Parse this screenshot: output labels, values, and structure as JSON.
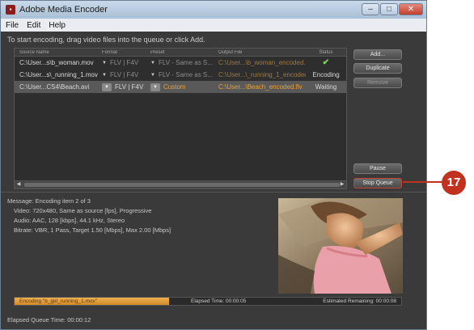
{
  "window": {
    "title": "Adobe Media Encoder",
    "app_icon": "Ae-icon"
  },
  "menu": [
    "File",
    "Edit",
    "Help"
  ],
  "hint": "To start encoding, drag video files into the queue or click Add.",
  "queue": {
    "columns": [
      "Source Name",
      "Format",
      "Preset",
      "Output File",
      "Status"
    ],
    "rows": [
      {
        "source": "C:\\User...s\\b_woman.mov",
        "format": "FLV | F4V",
        "preset": "FLV - Same as S...",
        "output": "C:\\User...\\b_woman_encoded.flv",
        "status": "",
        "status_icon": "check-icon",
        "state": "done"
      },
      {
        "source": "C:\\User...s\\_running_1.mov",
        "format": "FLV | F4V",
        "preset": "FLV - Same as S...",
        "output": "C:\\User...\\_running_1_encoded.flv",
        "status": "Encoding",
        "state": "encoding"
      },
      {
        "source": "C:\\User...CS4\\Beach.avi",
        "format": "FLV | F4V",
        "preset": "Custom",
        "output": "C:\\User...\\Beach_encoded.flv",
        "status": "Waiting",
        "state": "waiting"
      }
    ]
  },
  "buttons": {
    "add": "Add...",
    "duplicate": "Duplicate",
    "remove": "Remove",
    "pause": "Pause",
    "stop_queue": "Stop Queue"
  },
  "callout": "17",
  "message": {
    "line1": "Message: Encoding item 2 of 3",
    "video": "Video:  720x480, Same as source [fps], Progressive",
    "audio": "Audio:  AAC, 128 [kbps], 44.1 kHz, Stereo",
    "bitrate": "Bitrate:  VBR, 1 Pass, Target 1.50 [Mbps], Max 2.00 [Mbps]"
  },
  "progress": {
    "label": "Encoding \"b_girl_running_1.mov\"",
    "fraction": 0.4,
    "elapsed": "Elapsed Time:  00:00:05",
    "remaining": "Estimated Remaining:  00:00:08"
  },
  "queue_time": "Elapsed Queue Time:  00:00:12",
  "colors": {
    "accent": "#e8a23a",
    "callout": "#c0311e",
    "panel": "#3a3a3a"
  }
}
